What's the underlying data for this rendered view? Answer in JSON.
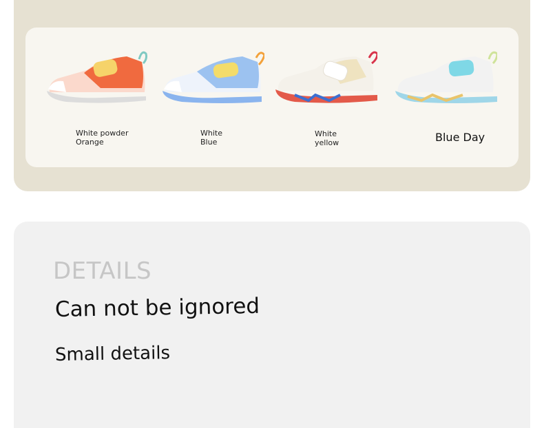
{
  "variants": [
    {
      "line1": "White powder",
      "line2": "Orange",
      "accent": "#f06a3f",
      "tab": "#f6d36a",
      "loop": "#7fc9c2",
      "sole": "#d9d9d9"
    },
    {
      "line1": "White",
      "line2": "Blue",
      "accent": "#7fb0ec",
      "tab": "#f4dc6a",
      "loop": "#f3a13a",
      "sole": "#8ab4ee"
    },
    {
      "line1": "White",
      "line2": "yellow",
      "accent": "#efe3c0",
      "tab": "#ffffff",
      "loop": "#d8344b",
      "sole": "#e35a4a"
    },
    {
      "line1": "Blue Day",
      "line2": "",
      "accent": "#eeeeee",
      "tab": "#7fd8e6",
      "loop": "#cfe39a",
      "sole": "#9fd6e8"
    }
  ],
  "details": {
    "heading": "DETAILS",
    "line1": "Can not be ignored",
    "line2": "Small details"
  }
}
